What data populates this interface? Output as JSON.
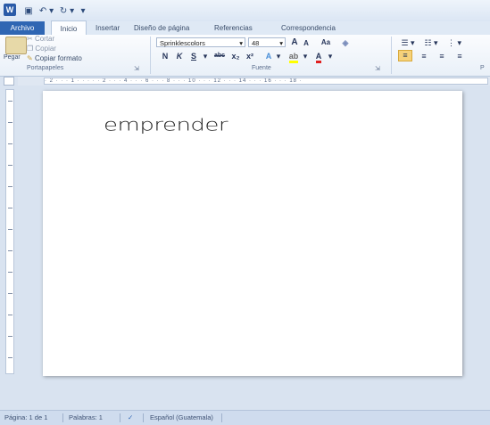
{
  "tabs": [
    "Archivo",
    "Inicio",
    "Insertar",
    "Diseño de página",
    "Referencias",
    "Correspondencia"
  ],
  "clipboard": {
    "paste": "Pegar",
    "cut": "Cortar",
    "copy": "Copiar",
    "format_painter": "Copiar formato",
    "group_label": "Portapapeles"
  },
  "font": {
    "name": "Sprinklescolors",
    "size": "48",
    "group_label": "Fuente",
    "bold": "N",
    "italic": "K",
    "underline": "S",
    "strike": "abc",
    "subscript": "x₂",
    "superscript": "x²",
    "grow": "A",
    "shrink": "A",
    "case": "Aa"
  },
  "paragraph": {
    "group_label": "P"
  },
  "ruler_marks": "· 2 · · · 1 · · · · · 2 · · · 4 · · · 6 · · · 8 · · · 10 · · · 12 · · · 14 · · · 16 · · · 18 ·",
  "document": {
    "text": "emprender"
  },
  "status": {
    "page": "Página: 1 de 1",
    "words": "Palabras: 1",
    "language": "Español (Guatemala)"
  },
  "colors": {
    "file_tab": "#2f66b3",
    "highlight": "#ffff00",
    "font_color": "#e02020"
  }
}
